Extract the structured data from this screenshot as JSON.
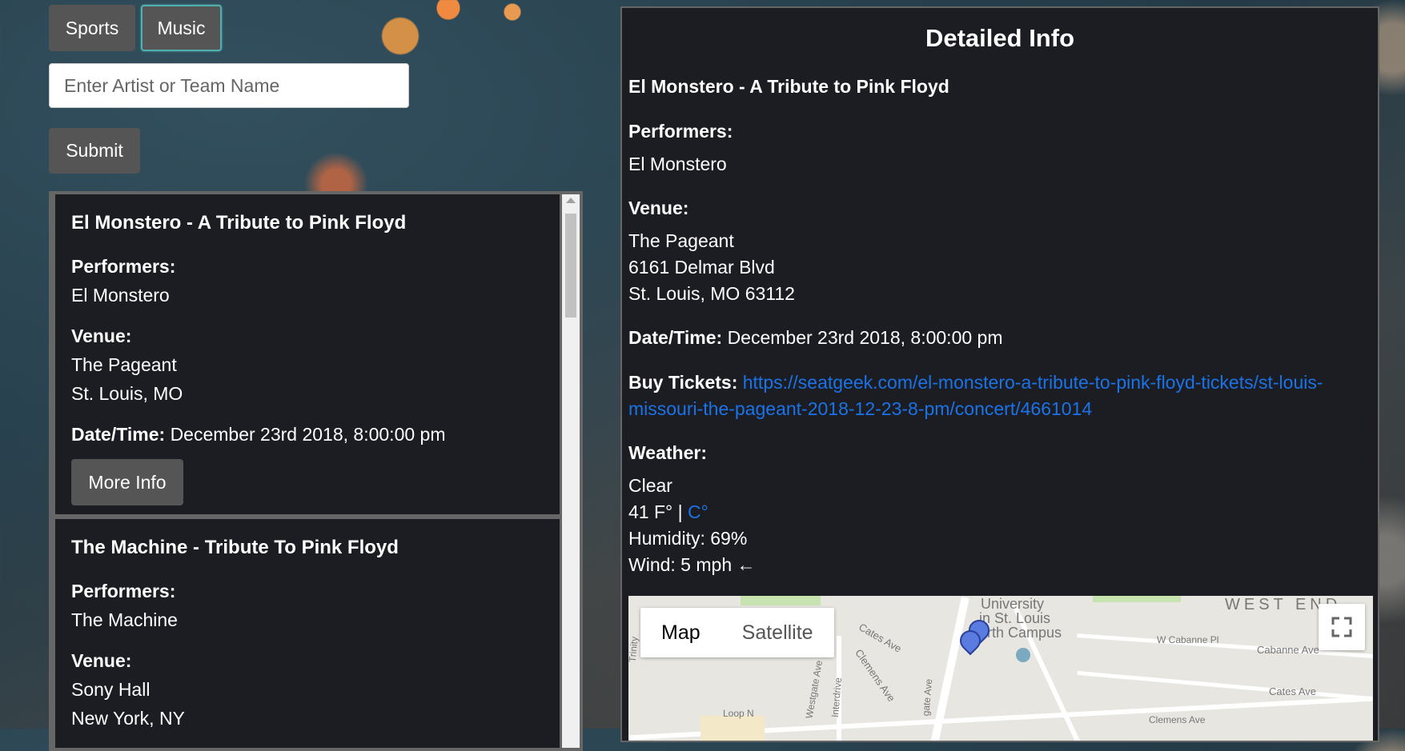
{
  "categories": {
    "sports": "Sports",
    "music": "Music"
  },
  "search": {
    "placeholder": "Enter Artist or Team Name"
  },
  "submit_label": "Submit",
  "results": [
    {
      "title": "El Monstero - A Tribute to Pink Floyd",
      "performers_label": "Performers:",
      "performers": "El Monstero",
      "venue_label": "Venue:",
      "venue_name": "The Pageant",
      "venue_city": "St. Louis, MO",
      "datetime_label": "Date/Time:",
      "datetime": "December 23rd 2018, 8:00:00 pm",
      "more_label": "More Info"
    },
    {
      "title": "The Machine - Tribute To Pink Floyd",
      "performers_label": "Performers:",
      "performers": "The Machine",
      "venue_label": "Venue:",
      "venue_name": "Sony Hall",
      "venue_city": "New York, NY"
    }
  ],
  "detail": {
    "heading": "Detailed Info",
    "title": "El Monstero - A Tribute to Pink Floyd",
    "performers_label": "Performers:",
    "performers": "El Monstero",
    "venue_label": "Venue:",
    "venue_name": "The Pageant",
    "venue_address": "6161 Delmar Blvd",
    "venue_city": "St. Louis, MO 63112",
    "datetime_label": "Date/Time:",
    "datetime": "December 23rd 2018, 8:00:00 pm",
    "tickets_label": "Buy Tickets:",
    "tickets_url_line1": "https://seatgeek.com/el-monstero-a-tribute-to-pink-floyd-tickets/st-louis-",
    "tickets_url_line2": "missouri-the-pageant-2018-12-23-8-pm/concert/4661014",
    "weather_label": "Weather:",
    "weather_condition": "Clear",
    "temperature": "41 F°",
    "temp_separator": "|",
    "celsius_link": "C°",
    "humidity": "Humidity: 69%",
    "wind": "Wind: 5 mph ←"
  },
  "map": {
    "map_label": "Map",
    "satellite_label": "Satellite",
    "labels": [
      "University",
      "in St. Louis",
      "orth Campus",
      "WEST END",
      "W Cabanne Pl",
      "Cabanne Ave",
      "Cates Ave",
      "Cates Ave",
      "Clemens Ave",
      "Clemens Ave",
      "Westgate Ave",
      "Interdrive",
      "Loop N",
      "gate Ave",
      "Trinity"
    ]
  },
  "colors": {
    "link": "#1a73e8",
    "panel_bg": "#1c1d22",
    "button_bg": "#555555",
    "active_border": "#4fb0b0"
  }
}
